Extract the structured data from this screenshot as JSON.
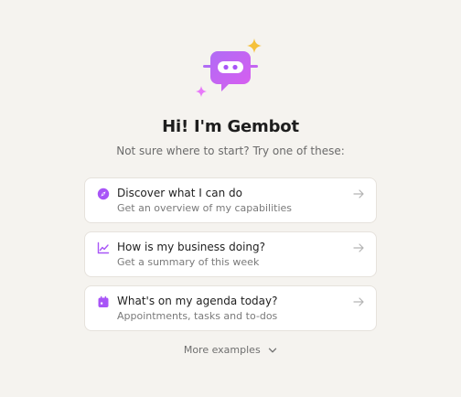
{
  "header": {
    "title": "Hi! I'm Gembot",
    "subtitle": "Not sure where to start? Try one of these:"
  },
  "suggestions": [
    {
      "title": "Discover what I can do",
      "description": "Get an overview of my capabilities",
      "icon": "compass-icon"
    },
    {
      "title": "How is my business doing?",
      "description": "Get a summary of this week",
      "icon": "chart-line-icon"
    },
    {
      "title": "What's on my agenda today?",
      "description": "Appointments, tasks and to-dos",
      "icon": "calendar-icon"
    }
  ],
  "more": {
    "label": "More examples"
  },
  "colors": {
    "accent": "#a855f7",
    "sparkle_yellow": "#f5c13b",
    "sparkle_pink": "#e879f9"
  }
}
